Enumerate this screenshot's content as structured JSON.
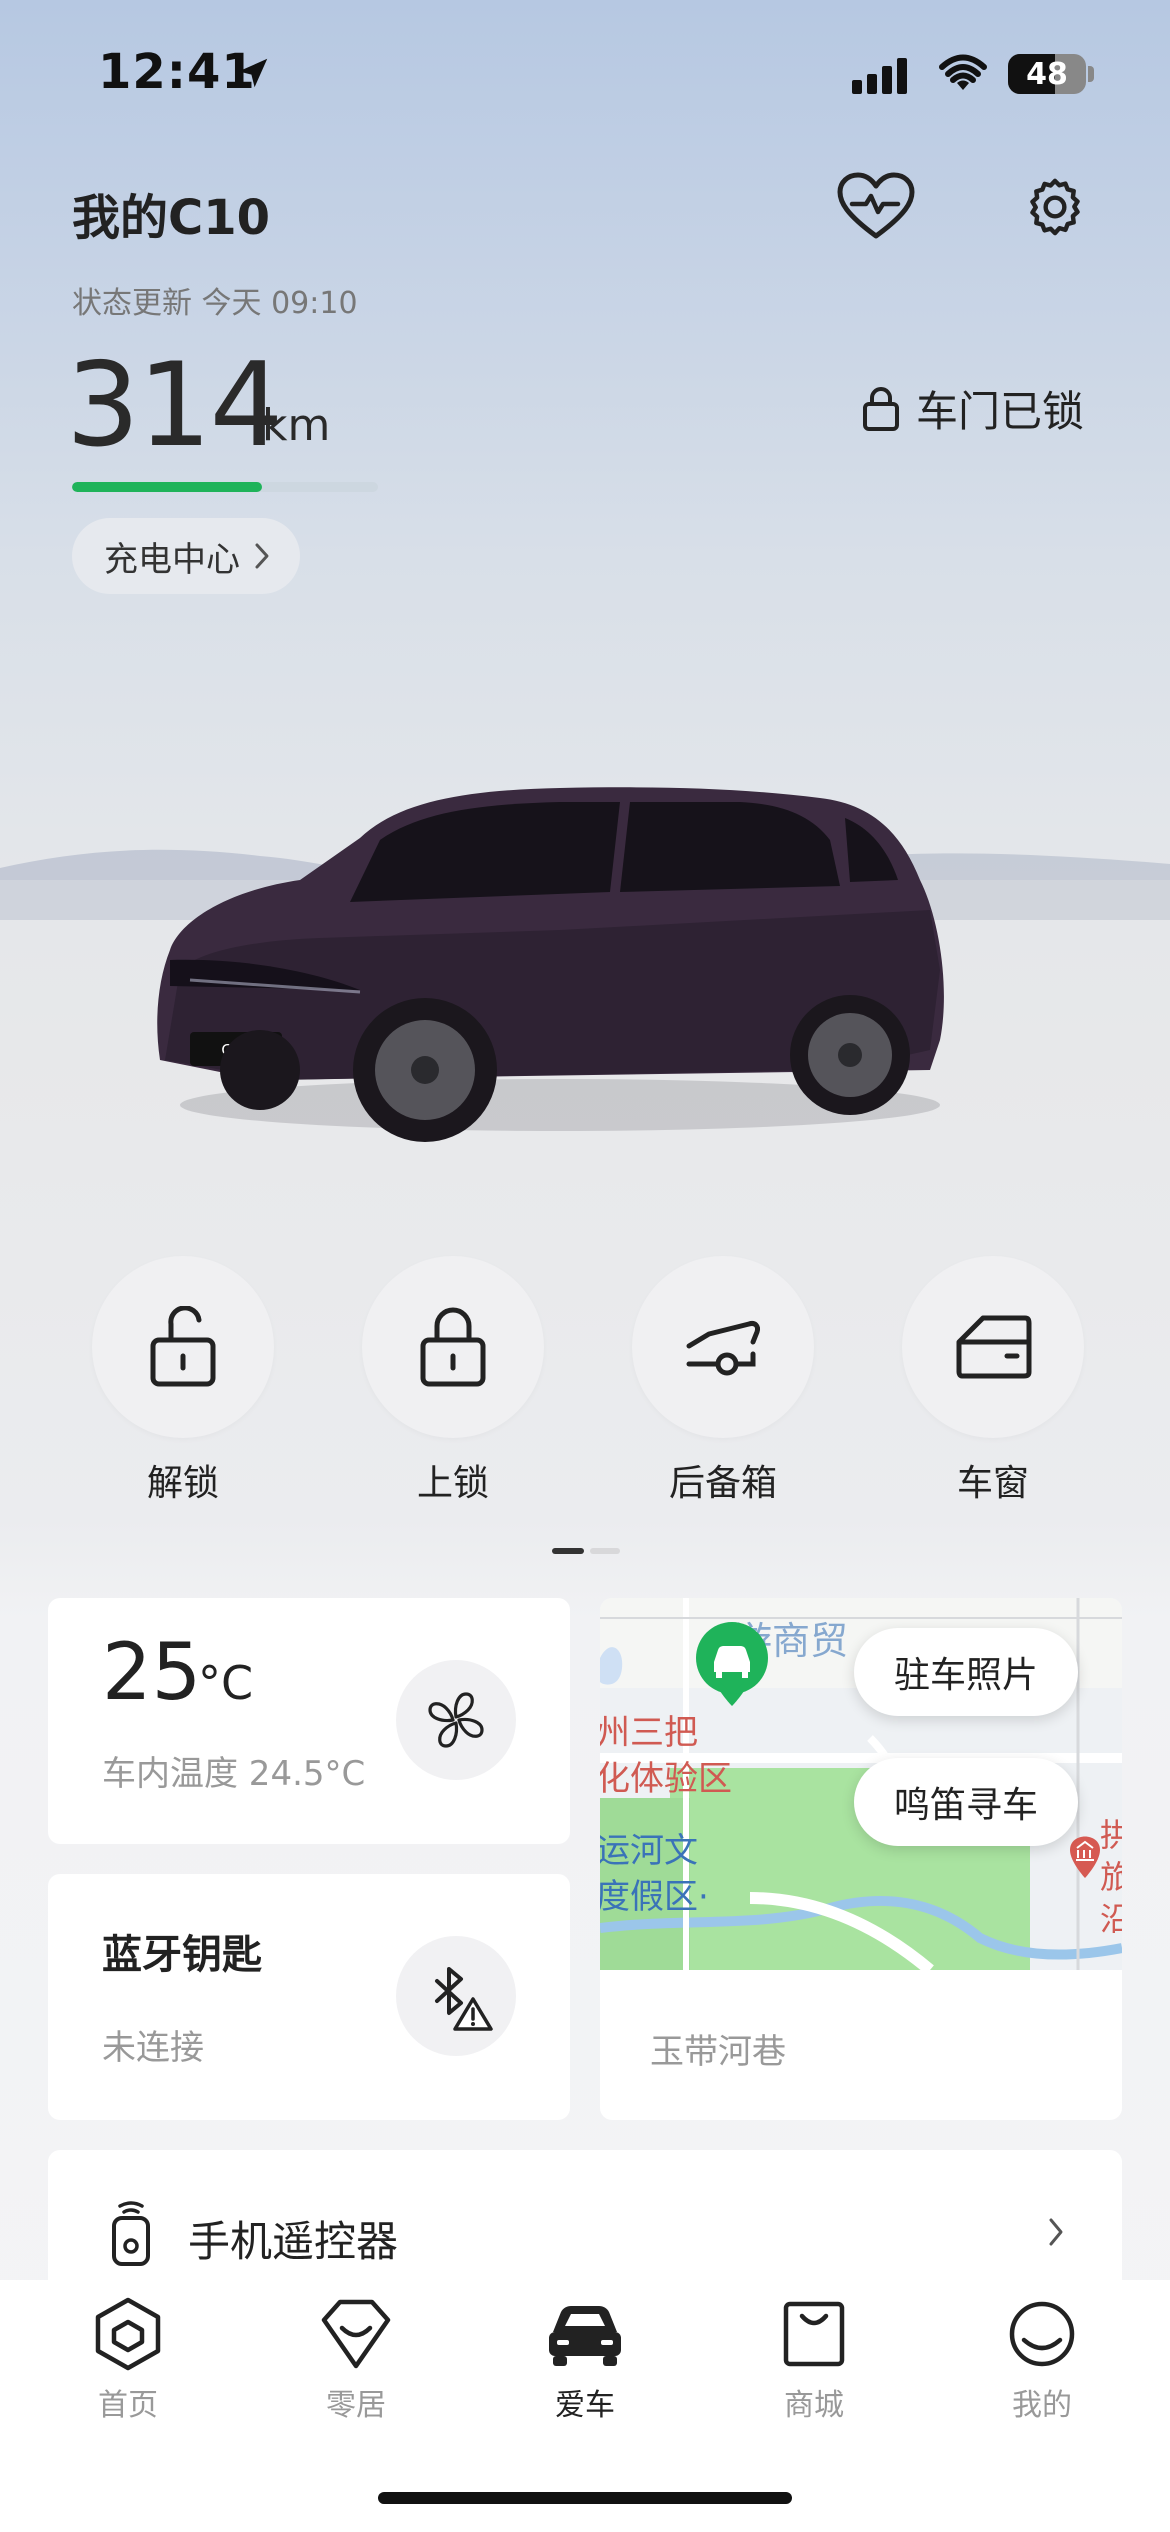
{
  "status_bar": {
    "time": "12:41",
    "battery": "48"
  },
  "header": {
    "title": "我的C10",
    "status_update": "状态更新 今天 09:10"
  },
  "range": {
    "value": "314",
    "unit": "km",
    "level_percent": 62,
    "bar_color": "#1fb35a"
  },
  "door_status": "车门已锁",
  "charging_center": "充电中心",
  "car_plate": "C10",
  "controls": [
    {
      "label": "解锁",
      "icon": "unlock-icon"
    },
    {
      "label": "上锁",
      "icon": "lock-icon"
    },
    {
      "label": "后备箱",
      "icon": "trunk-icon"
    },
    {
      "label": "车窗",
      "icon": "window-icon"
    }
  ],
  "climate": {
    "temp": "25",
    "unit": "°C",
    "interior": "车内温度 24.5°C"
  },
  "bluetooth": {
    "title": "蓝牙钥匙",
    "status": "未连接"
  },
  "map": {
    "parking_photo": "驻车照片",
    "horn_find": "鸣笛寻车",
    "address": "玉带河巷",
    "labels": {
      "l1": "游商贸",
      "l2": "州三把",
      "l3": "化体验区",
      "l4": "运河文",
      "l5": "度假区·",
      "l6": "拱",
      "l7": "旅",
      "l8": "沿"
    }
  },
  "remote": {
    "label": "手机遥控器"
  },
  "tabs": [
    {
      "label": "首页",
      "icon": "hexagon-home-icon"
    },
    {
      "label": "零居",
      "icon": "heart-home-icon"
    },
    {
      "label": "爱车",
      "icon": "car-icon"
    },
    {
      "label": "商城",
      "icon": "shopping-bag-icon"
    },
    {
      "label": "我的",
      "icon": "profile-icon"
    }
  ],
  "active_tab": "爱车"
}
